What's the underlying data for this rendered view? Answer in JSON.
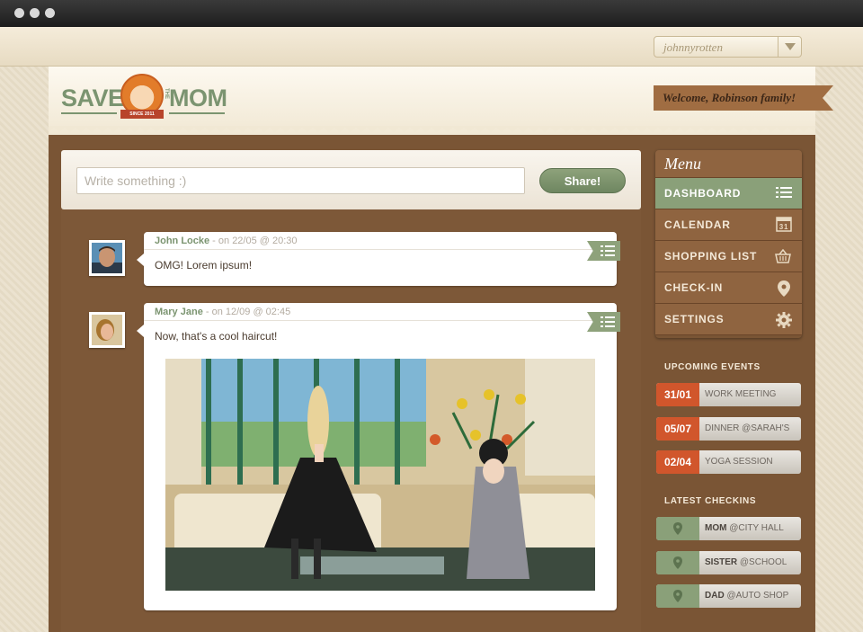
{
  "user_select": {
    "value": "johnnyrotten"
  },
  "logo": {
    "left": "SAVE",
    "mid": "THE",
    "right": "MOM",
    "badge": "SINCE 2011"
  },
  "welcome": "Welcome, Robinson family!",
  "composer": {
    "placeholder": "Write something :)",
    "share_label": "Share!"
  },
  "posts": [
    {
      "author": "John Locke",
      "meta": " - on 22/05 @ 20:30",
      "text": "OMG! Lorem ipsum!"
    },
    {
      "author": "Mary Jane",
      "meta": " - on 12/09 @ 02:45",
      "text": "Now,  that's a cool haircut!"
    }
  ],
  "menu": {
    "title": "Menu",
    "items": [
      {
        "label": "DASHBOARD",
        "icon": "list-icon"
      },
      {
        "label": "CALENDAR",
        "icon": "calendar-icon",
        "icon_text": "31"
      },
      {
        "label": "SHOPPING LIST",
        "icon": "basket-icon"
      },
      {
        "label": "CHECK-IN",
        "icon": "map-pin-icon"
      },
      {
        "label": "SETTINGS",
        "icon": "gear-icon"
      }
    ]
  },
  "upcoming": {
    "title": "UPCOMING EVENTS",
    "items": [
      {
        "date": "31/01",
        "label": "WORK MEETING"
      },
      {
        "date": "05/07",
        "label": "DINNER @SARAH'S"
      },
      {
        "date": "02/04",
        "label": "YOGA SESSION"
      }
    ]
  },
  "checkins": {
    "title": "LATEST CHECKINS",
    "items": [
      {
        "who": "MOM",
        "where": " @CITY HALL"
      },
      {
        "who": "SISTER",
        "where": " @SCHOOL"
      },
      {
        "who": "DAD",
        "where": " @AUTO SHOP"
      }
    ]
  },
  "colors": {
    "accent_green": "#8aa079",
    "brown": "#7a5535",
    "event_orange": "#d1562c"
  }
}
